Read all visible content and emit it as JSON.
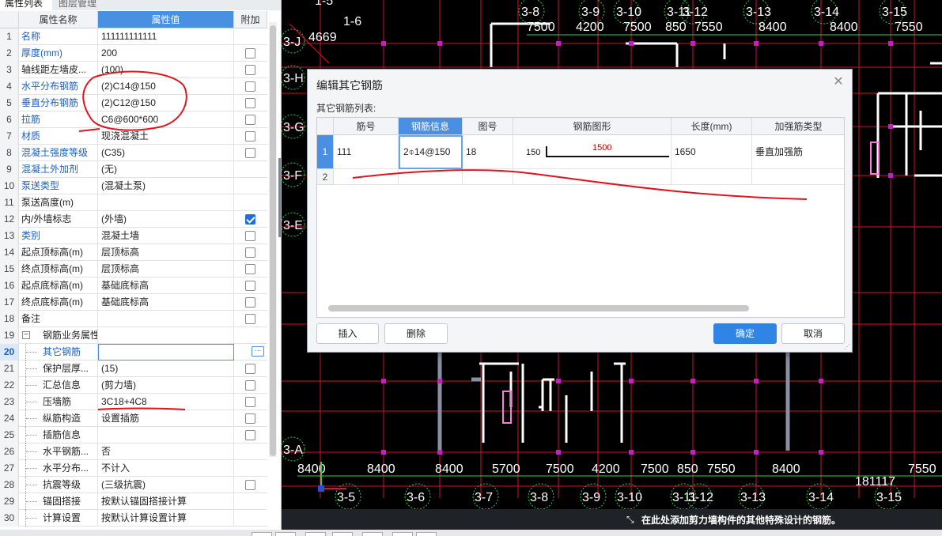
{
  "panel": {
    "tabs": [
      "属性列表",
      "图层管理"
    ],
    "headers": {
      "name": "属性名称",
      "value": "属性值",
      "extra": "附加"
    },
    "rows": [
      {
        "n": "1",
        "name": "名称",
        "value": "111111111111",
        "blue": true,
        "check": null
      },
      {
        "n": "2",
        "name": "厚度(mm)",
        "value": "200",
        "blue": true,
        "check": false
      },
      {
        "n": "3",
        "name": "轴线距左墙皮...",
        "value": "(100)",
        "blue": false,
        "check": false
      },
      {
        "n": "4",
        "name": "水平分布钢筋",
        "value": "(2)C14@150",
        "blue": true,
        "check": false
      },
      {
        "n": "5",
        "name": "垂直分布钢筋",
        "value": "(2)C12@150",
        "blue": true,
        "check": false
      },
      {
        "n": "6",
        "name": "拉筋",
        "value": "C6@600*600",
        "blue": true,
        "check": false
      },
      {
        "n": "7",
        "name": "材质",
        "value": "现浇混凝土",
        "blue": true,
        "check": false
      },
      {
        "n": "8",
        "name": "混凝土强度等级",
        "value": "(C35)",
        "blue": true,
        "check": false
      },
      {
        "n": "9",
        "name": "混凝土外加剂",
        "value": "(无)",
        "blue": true,
        "check": null
      },
      {
        "n": "10",
        "name": "泵送类型",
        "value": "(混凝土泵)",
        "blue": true,
        "check": null
      },
      {
        "n": "11",
        "name": "泵送高度(m)",
        "value": "",
        "blue": false,
        "check": null
      },
      {
        "n": "12",
        "name": "内/外墙标志",
        "value": "(外墙)",
        "blue": false,
        "check": true
      },
      {
        "n": "13",
        "name": "类别",
        "value": "混凝土墙",
        "blue": true,
        "check": false
      },
      {
        "n": "14",
        "name": "起点顶标高(m)",
        "value": "层顶标高",
        "blue": false,
        "check": false
      },
      {
        "n": "15",
        "name": "终点顶标高(m)",
        "value": "层顶标高",
        "blue": false,
        "check": false
      },
      {
        "n": "16",
        "name": "起点底标高(m)",
        "value": "基础底标高",
        "blue": false,
        "check": false
      },
      {
        "n": "17",
        "name": "终点底标高(m)",
        "value": "基础底标高",
        "blue": false,
        "check": false
      },
      {
        "n": "18",
        "name": "备注",
        "value": "",
        "blue": false,
        "check": false
      },
      {
        "n": "19",
        "name": "钢筋业务属性",
        "value": "",
        "blue": false,
        "check": null,
        "group": true
      },
      {
        "n": "20",
        "name": "其它钢筋",
        "value": "",
        "blue": true,
        "check": null,
        "child": true,
        "active": true
      },
      {
        "n": "21",
        "name": "保护层厚...",
        "value": "(15)",
        "blue": false,
        "check": false,
        "child": true
      },
      {
        "n": "22",
        "name": "汇总信息",
        "value": "(剪力墙)",
        "blue": false,
        "check": false,
        "child": true
      },
      {
        "n": "23",
        "name": "压墙筋",
        "value": "3C18+4C8",
        "blue": false,
        "check": false,
        "child": true
      },
      {
        "n": "24",
        "name": "纵筋构造",
        "value": "设置插筋",
        "blue": false,
        "check": false,
        "child": true
      },
      {
        "n": "25",
        "name": "插筋信息",
        "value": "",
        "blue": false,
        "check": false,
        "child": true
      },
      {
        "n": "26",
        "name": "水平钢筋...",
        "value": "否",
        "blue": false,
        "check": null,
        "child": true
      },
      {
        "n": "27",
        "name": "水平分布...",
        "value": "不计入",
        "blue": false,
        "check": null,
        "child": true
      },
      {
        "n": "28",
        "name": "抗震等级",
        "value": "(三级抗震)",
        "blue": false,
        "check": false,
        "child": true
      },
      {
        "n": "29",
        "name": "锚固搭接",
        "value": "按默认锚固搭接计算",
        "blue": false,
        "check": null,
        "child": true
      },
      {
        "n": "30",
        "name": "计算设置",
        "value": "按默认计算设置计算",
        "blue": false,
        "check": null,
        "child": true
      }
    ]
  },
  "dialog": {
    "title": "编辑其它钢筋",
    "subtitle": "其它钢筋列表:",
    "columns": [
      "筋号",
      "钢筋信息",
      "图号",
      "钢筋图形",
      "长度(mm)",
      "加强筋类型"
    ],
    "rows": [
      {
        "n": "1",
        "bar_no": "111",
        "info": "2⌽14@150",
        "fig": "18",
        "shape_left": "150",
        "shape_mid": "1500",
        "length": "1650",
        "type": "垂直加强筋"
      },
      {
        "n": "2",
        "bar_no": "",
        "info": "",
        "fig": "",
        "length": "",
        "type": ""
      }
    ],
    "buttons": {
      "insert": "插入",
      "delete": "删除",
      "ok": "确定",
      "cancel": "取消"
    }
  },
  "cad": {
    "top_axes": [
      "3-8",
      "3-9",
      "3-10",
      "3-11",
      "3-12",
      "3-13",
      "3-14",
      "3-15"
    ],
    "top_dims": [
      "7500",
      "4200",
      "7500",
      "850",
      "7550",
      "8400",
      "8400",
      "7550"
    ],
    "bottom_dims": [
      "8400",
      "8400",
      "8400",
      "5700",
      "7500",
      "4200",
      "7500",
      "850",
      "7550",
      "8400",
      "7550"
    ],
    "bottom_axes": [
      "3-5",
      "3-6",
      "3-7",
      "3-8",
      "3-9",
      "3-10",
      "3-11",
      "3-12",
      "3-13",
      "3-14",
      "3-15"
    ],
    "left_axes": [
      "3-J",
      "3-H",
      "3-G",
      "3-F",
      "3-E",
      "3-A"
    ],
    "misc_labels": [
      "1-5",
      "1-6",
      "4669",
      "181117"
    ],
    "colors": {
      "grid": "#d4122a",
      "axis_bubble": "#2bd14a",
      "wall": "#ffffff",
      "beam": "#8a8fa3",
      "pink": "#ff7ad9"
    }
  },
  "status": {
    "text": "在此处添加剪力墙构件的其他特殊设计的钢筋。"
  }
}
